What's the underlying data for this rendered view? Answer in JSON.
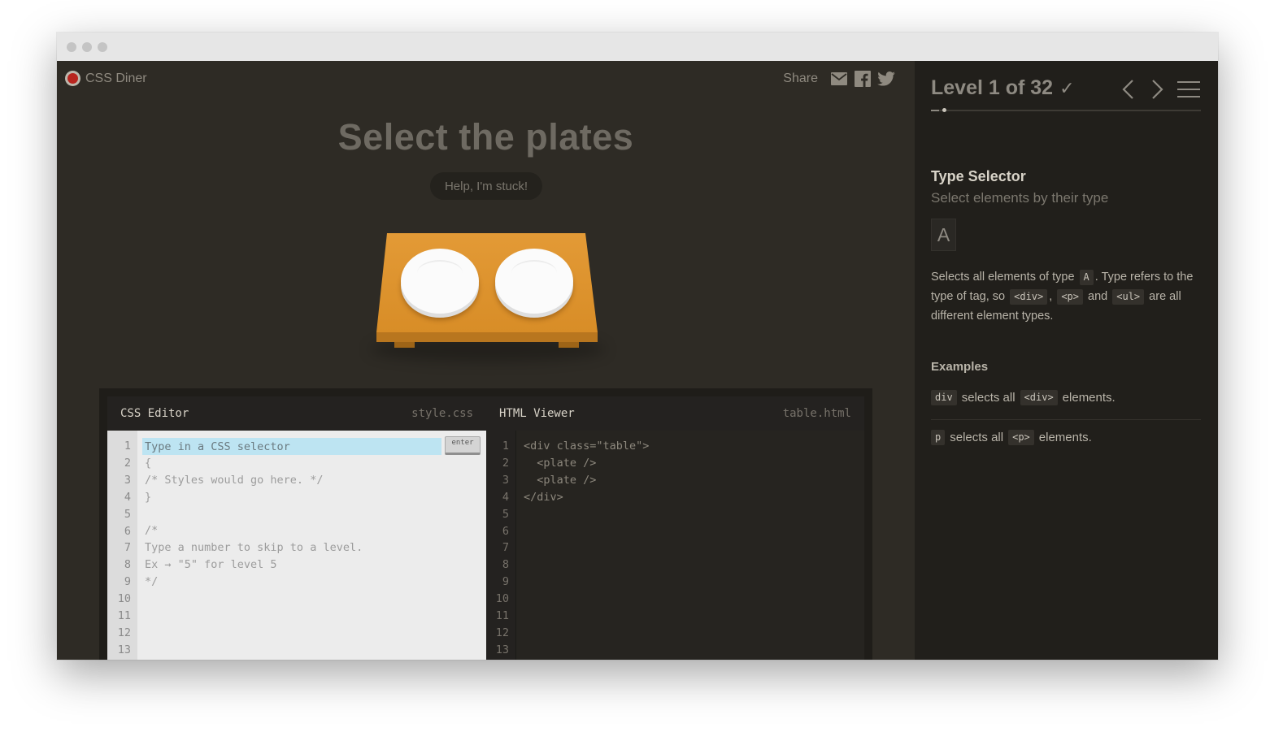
{
  "app": {
    "logo_text": "CSS Diner"
  },
  "header": {
    "share_label": "Share",
    "share_icons": [
      "mail-icon",
      "facebook-icon",
      "twitter-icon"
    ]
  },
  "main": {
    "instruction": "Select the plates",
    "help_button": "Help, I'm stuck!"
  },
  "css_editor": {
    "title": "CSS Editor",
    "filename": "style.css",
    "input_placeholder": "Type in a CSS selector",
    "enter_label": "enter",
    "line_numbers": [
      "1",
      "2",
      "3",
      "4",
      "5",
      "6",
      "7",
      "8",
      "9",
      "10",
      "11",
      "12",
      "13"
    ],
    "lines": [
      "",
      "{",
      "/* Styles would go here. */",
      "}",
      "",
      "/*",
      "Type a number to skip to a level.",
      "Ex → \"5\" for level 5",
      "*/",
      "",
      "",
      "",
      ""
    ]
  },
  "html_viewer": {
    "title": "HTML Viewer",
    "filename": "table.html",
    "line_numbers": [
      "1",
      "2",
      "3",
      "4",
      "5",
      "6",
      "7",
      "8",
      "9",
      "10",
      "11",
      "12",
      "13"
    ],
    "lines": [
      "<div class=\"table\">",
      "  <plate />",
      "  <plate />",
      "</div>",
      "",
      "",
      "",
      "",
      "",
      "",
      "",
      "",
      ""
    ]
  },
  "sidebar": {
    "level_text": "Level 1 of 32",
    "check_mark": "✓",
    "progress_fraction": 0.031,
    "selector_name": "Type Selector",
    "selector_subtitle": "Select elements by their type",
    "syntax": "A",
    "desc_1": "Selects all elements of type ",
    "desc_tag_a": "A",
    "desc_2": ". Type refers to the type of tag, so ",
    "desc_tag_div": "<div>",
    "desc_comma": ", ",
    "desc_tag_p": "<p>",
    "desc_and": " and ",
    "desc_tag_ul": "<ul>",
    "desc_3": " are all different element types.",
    "examples_title": "Examples",
    "examples": [
      {
        "tag": "div",
        "text": "selects all",
        "element": "<div>",
        "suffix": "elements."
      },
      {
        "tag": "p",
        "text": "selects all",
        "element": "<p>",
        "suffix": "elements."
      }
    ]
  },
  "colors": {
    "table": "#e0962f",
    "plate": "#fbfbfb",
    "selector_input_bg": "#bde4f2",
    "logo_red": "#b8251f"
  }
}
